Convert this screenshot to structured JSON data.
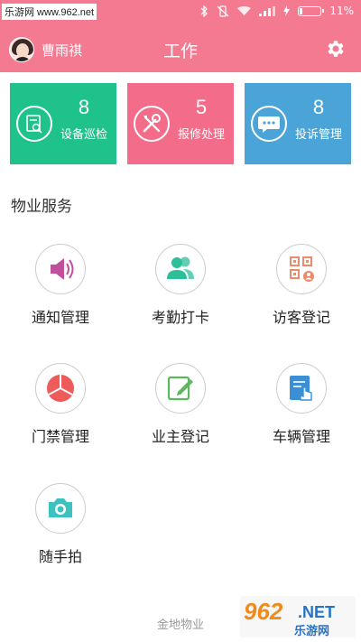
{
  "status_bar": {
    "watermark": "乐游网 www.962.net",
    "battery": "11%",
    "battery_level_percent": 11,
    "icons": [
      "bluetooth-icon",
      "vibrate-off-icon",
      "wifi-icon",
      "signal-icon",
      "charging-icon",
      "battery-icon"
    ]
  },
  "header": {
    "username": "曹雨祺",
    "title": "工作",
    "settings_icon": "gear-icon",
    "background_color": "#f47a92"
  },
  "stats": [
    {
      "count": "8",
      "label": "设备巡检",
      "icon": "inspection-icon",
      "color": "#1fc28a"
    },
    {
      "count": "5",
      "label": "报修处理",
      "icon": "tools-icon",
      "color": "#f36d8a"
    },
    {
      "count": "8",
      "label": "投诉管理",
      "icon": "chat-bubble-icon",
      "color": "#4aa4d8"
    }
  ],
  "section": {
    "title": "物业服务"
  },
  "services": [
    {
      "label": "通知管理",
      "icon": "speaker-icon",
      "color": "#c0509b"
    },
    {
      "label": "考勤打卡",
      "icon": "users-icon",
      "color": "#2dbf9a"
    },
    {
      "label": "访客登记",
      "icon": "qr-visitor-icon",
      "color": "#ec8a6a"
    },
    {
      "label": "门禁管理",
      "icon": "pie-chart-icon",
      "color": "#ee5b5b"
    },
    {
      "label": "业主登记",
      "icon": "edit-icon",
      "color": "#5cb85c"
    },
    {
      "label": "车辆管理",
      "icon": "touch-doc-icon",
      "color": "#3b8fd6"
    },
    {
      "label": "随手拍",
      "icon": "camera-icon",
      "color": "#3ec2c0"
    }
  ],
  "footer": {
    "text": "金地物业"
  },
  "watermark_962": {
    "logo": "962",
    "domain": ".NET",
    "brand": "乐游网"
  }
}
